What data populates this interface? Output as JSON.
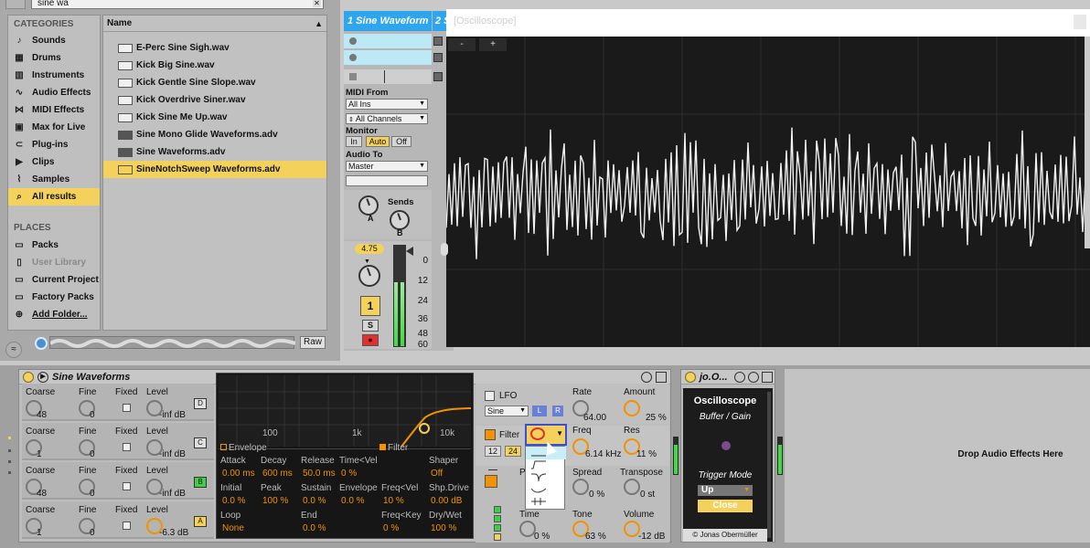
{
  "browser": {
    "search_value": "sine wa",
    "categories_title": "CATEGORIES",
    "categories": [
      {
        "label": "Sounds",
        "icon": "note-icon"
      },
      {
        "label": "Drums",
        "icon": "drums-icon"
      },
      {
        "label": "Instruments",
        "icon": "instruments-icon"
      },
      {
        "label": "Audio Effects",
        "icon": "audio-effects-icon"
      },
      {
        "label": "MIDI Effects",
        "icon": "midi-effects-icon"
      },
      {
        "label": "Max for Live",
        "icon": "max-for-live-icon"
      },
      {
        "label": "Plug-ins",
        "icon": "plugins-icon"
      },
      {
        "label": "Clips",
        "icon": "clips-icon"
      },
      {
        "label": "Samples",
        "icon": "samples-icon"
      },
      {
        "label": "All results",
        "icon": "search-icon",
        "active": true
      }
    ],
    "places_title": "PLACES",
    "places": [
      {
        "label": "Packs",
        "icon": "packs-icon"
      },
      {
        "label": "User Library",
        "icon": "user-icon",
        "dim": true
      },
      {
        "label": "Current Project",
        "icon": "folder-icon"
      },
      {
        "label": "Factory Packs",
        "icon": "folder-icon"
      },
      {
        "label": "Add Folder...",
        "icon": "add-icon"
      }
    ],
    "file_header": "Name",
    "files": [
      {
        "label": "E-Perc Sine Sigh.wav",
        "type": "wav"
      },
      {
        "label": "Kick Big Sine.wav",
        "type": "wav"
      },
      {
        "label": "Kick Gentle Sine Slope.wav",
        "type": "wav"
      },
      {
        "label": "Kick Overdrive Siner.wav",
        "type": "wav"
      },
      {
        "label": "Kick Sine Me Up.wav",
        "type": "wav"
      },
      {
        "label": "Sine Mono Glide Waveforms.adv",
        "type": "adv"
      },
      {
        "label": "Sine Waveforms.adv",
        "type": "adv"
      },
      {
        "label": "SineNotchSweep Waveforms.adv",
        "type": "adv",
        "active": true
      }
    ],
    "raw_label": "Raw"
  },
  "track": {
    "name": "1 Sine Waveform",
    "name2": "2 S",
    "midi_from_label": "MIDI From",
    "midi_from_value": "All Ins",
    "channels_value": "All Channels",
    "monitor_label": "Monitor",
    "monitor_in": "In",
    "monitor_auto": "Auto",
    "monitor_off": "Off",
    "audio_to_label": "Audio To",
    "audio_to_value": "Master",
    "sends_label": "Sends",
    "send_a": "A",
    "send_b": "B",
    "volume_value": "4.75",
    "track_number": "1",
    "solo_label": "S",
    "arm_label": "●",
    "db_scale": [
      "0",
      "12",
      "24",
      "36",
      "48",
      "60"
    ]
  },
  "oscilloscope_window": {
    "title": "[Oscilloscope]",
    "minus_label": "-",
    "plus_label": "+"
  },
  "instrument": {
    "title": "Sine Waveforms",
    "oscillators": [
      {
        "coarse": "48",
        "fine": "0",
        "level": "-inf dB",
        "tag": "D",
        "tag_color": "plain"
      },
      {
        "coarse": "1",
        "fine": "0",
        "level": "-inf dB",
        "tag": "C",
        "tag_color": "plain"
      },
      {
        "coarse": "48",
        "fine": "0",
        "level": "-inf dB",
        "tag": "B",
        "tag_color": "green"
      },
      {
        "coarse": "1",
        "fine": "0",
        "level": "-6.3 dB",
        "tag": "A",
        "tag_color": "yellow"
      }
    ],
    "col_coarse": "Coarse",
    "col_fine": "Fine",
    "col_fixed": "Fixed",
    "col_level": "Level",
    "graph_ticks": [
      "100",
      "1k",
      "10k"
    ],
    "envelope_tab": "Envelope",
    "filter_tab": "Filter",
    "env": {
      "attack_label": "Attack",
      "attack": "0.00 ms",
      "decay_label": "Decay",
      "decay": "600 ms",
      "release_label": "Release",
      "release": "50.0 ms",
      "timevel_label": "Time<Vel",
      "timevel": "0 %",
      "initial_label": "Initial",
      "initial": "0.0 %",
      "peak_label": "Peak",
      "peak": "100 %",
      "sustain_label": "Sustain",
      "sustain": "0.0 %",
      "envelope_label": "Envelope",
      "envelope": "0.0 %",
      "loop_label": "Loop",
      "loop": "None",
      "end_label": "End",
      "end": "0.0 %",
      "shaper_label": "Shaper",
      "shaper": "Off",
      "freqvel_label": "Freq<Vel",
      "freqvel": "10 %",
      "shpdrive_label": "Shp.Drive",
      "shpdrive": "0.00 dB",
      "freqkey_label": "Freq<Key",
      "freqkey": "0 %",
      "drywet_label": "Dry/Wet",
      "drywet": "100 %"
    },
    "lfo": {
      "label": "LFO",
      "wave": "Sine",
      "l_btn": "L",
      "r_btn": "R",
      "rate_label": "Rate",
      "rate": "64.00",
      "amount_label": "Amount",
      "amount": "25 %"
    },
    "filter": {
      "label": "Filter",
      "slope_12": "12",
      "slope_24": "24",
      "freq_label": "Freq",
      "freq": "6.14 kHz",
      "res_label": "Res",
      "res": "11 %"
    },
    "pitch": {
      "label": "P",
      "spread_label": "Spread",
      "spread": "0 %",
      "transpose_label": "Transpose",
      "transpose": "0 st",
      "time_label": "Time",
      "time": "0 %",
      "tone_label": "Tone",
      "tone": "63 %",
      "volume_label": "Volume",
      "volume": "-12 dB"
    }
  },
  "osc_device": {
    "title": "jo.O...",
    "name": "Oscilloscope",
    "buffer_label": "Buffer / Gain",
    "trigger_label": "Trigger Mode",
    "trigger_value": "Up",
    "close_label": "Close",
    "credit": "© Jonas Obermüller"
  },
  "drop_zone": {
    "label": "Drop Audio Effects Here"
  },
  "colors": {
    "accent_yellow": "#f3d15a",
    "track_blue": "#2da5ef",
    "orange": "#f29200",
    "meter_green": "#3fdc3f"
  }
}
